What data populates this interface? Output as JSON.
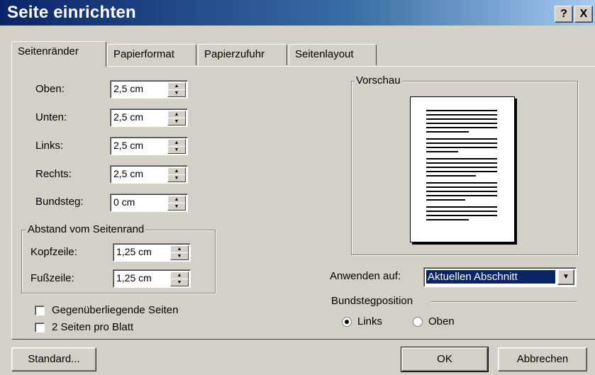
{
  "title": "Seite einrichten",
  "title_buttons": {
    "help": "?",
    "close": "X"
  },
  "tabs": [
    {
      "label": "Seitenränder",
      "active": true
    },
    {
      "label": "Papierformat",
      "active": false
    },
    {
      "label": "Papierzufuhr",
      "active": false
    },
    {
      "label": "Seitenlayout",
      "active": false
    }
  ],
  "margins": {
    "top_label": "Oben:",
    "top_value": "2,5 cm",
    "bottom_label": "Unten:",
    "bottom_value": "2,5 cm",
    "left_label": "Links:",
    "left_value": "2,5 cm",
    "right_label": "Rechts:",
    "right_value": "2,5 cm",
    "gutter_label": "Bundsteg:",
    "gutter_value": "0 cm"
  },
  "edge_group": {
    "title": "Abstand vom Seitenrand",
    "header_label": "Kopfzeile:",
    "header_value": "1,25 cm",
    "footer_label": "Fußzeile:",
    "footer_value": "1,25 cm"
  },
  "checkboxes": {
    "mirror": "Gegenüberliegende Seiten",
    "two_pages": "2 Seiten pro Blatt"
  },
  "preview": {
    "title": "Vorschau"
  },
  "apply_to": {
    "label": "Anwenden auf:",
    "value": "Aktuellen Abschnitt"
  },
  "gutter_position": {
    "title": "Bundstegposition",
    "left": "Links",
    "top": "Oben",
    "selected": "left"
  },
  "buttons": {
    "default": "Standard...",
    "ok": "OK",
    "cancel": "Abbrechen"
  },
  "colors": {
    "titlebar_start": "#0a246a",
    "titlebar_end": "#a6caf0",
    "selection": "#0a246a"
  }
}
